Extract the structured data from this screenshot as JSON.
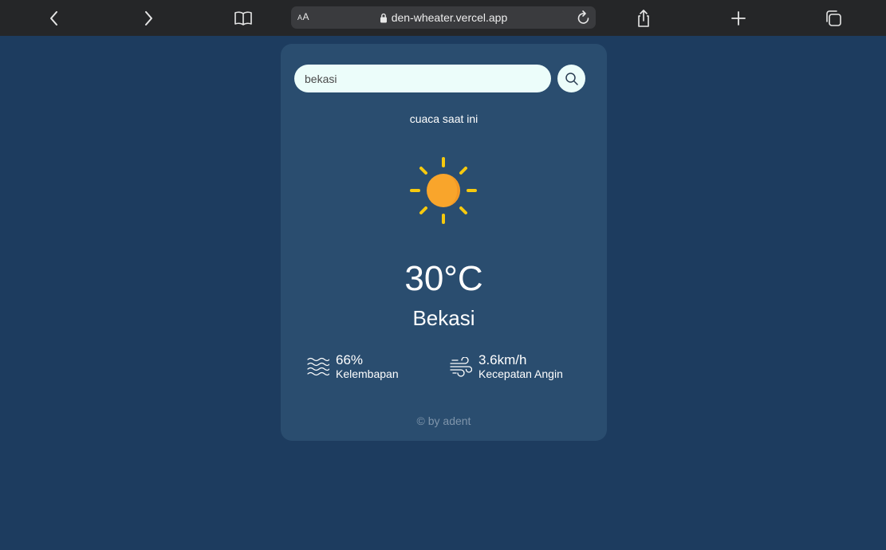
{
  "browser": {
    "aa_label": "AA",
    "url": "den-wheater.vercel.app"
  },
  "search": {
    "value": "bekasi",
    "placeholder": ""
  },
  "weather": {
    "subtitle": "cuaca saat ini",
    "icon": "sun-icon",
    "temperature": "30°C",
    "city": "Bekasi",
    "humidity_value": "66%",
    "humidity_label": "Kelembapan",
    "wind_value": "3.6km/h",
    "wind_label": "Kecepatan Angin"
  },
  "footer": {
    "text": "© by adent"
  },
  "colors": {
    "background": "#1d3c5f",
    "card": "#2a4d6f",
    "sun_core": "#f9a52b",
    "sun_rays": "#f6c90e",
    "input_bg": "#ecfdfa"
  }
}
